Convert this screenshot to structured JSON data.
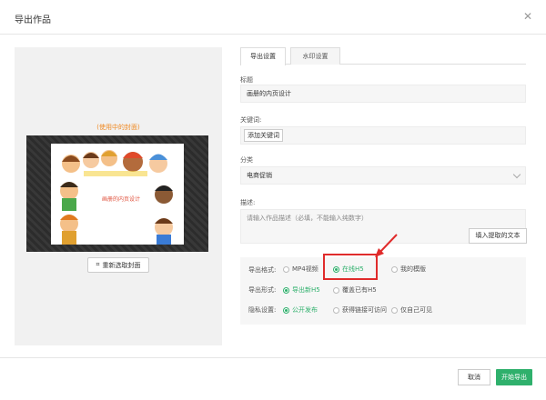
{
  "dialog": {
    "title": "导出作品",
    "close_icon": "close-icon"
  },
  "cover": {
    "hint": "(使用中的封面)",
    "image_title": "画册的内页设计",
    "reselect_label": "重新选取封面",
    "reselect_icon": "crop-icon"
  },
  "tabs": [
    {
      "label": "导出设置",
      "active": true
    },
    {
      "label": "水印设置",
      "active": false
    }
  ],
  "form": {
    "title_label": "标题",
    "title_value": "画册的内页设计",
    "keywords_label": "关键词:",
    "add_keyword_label": "添加关键词",
    "category_label": "分类",
    "category_value": "电商促销",
    "description_label": "描述:",
    "description_placeholder": "请输入作品描述（必填，不能输入纯数字）",
    "fill_extracted_label": "填入提取的文本"
  },
  "options": {
    "format": {
      "label": "导出格式:",
      "choices": [
        "MP4视频",
        "在线H5",
        "我的模版"
      ],
      "selected": "在线H5"
    },
    "mode": {
      "label": "导出形式:",
      "choices": [
        "导出新H5",
        "覆盖已有H5"
      ],
      "selected": "导出新H5"
    },
    "privacy": {
      "label": "隐私设置:",
      "choices": [
        "公开发布",
        "获得链接可访问",
        "仅自己可见"
      ],
      "selected": "公开发布"
    }
  },
  "footer": {
    "cancel_label": "取消",
    "export_label": "开始导出"
  },
  "colors": {
    "accent": "#2fb06c",
    "highlight": "#e02b2b",
    "hint": "#f08a24"
  }
}
